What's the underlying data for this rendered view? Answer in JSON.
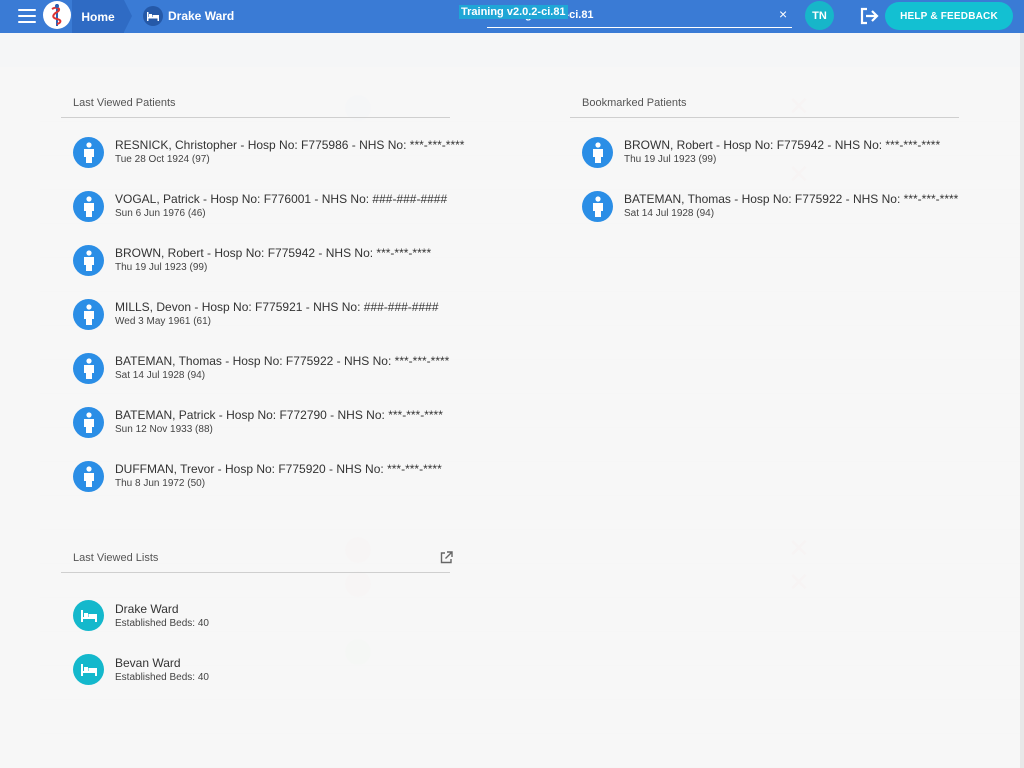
{
  "header": {
    "home_label": "Home",
    "ward_label": "Drake Ward",
    "search_value": "Training v2.0.2-ci.81",
    "clear_symbol": "×",
    "user_initials": "TN",
    "help_label": "HELP & FEEDBACK"
  },
  "colors": {
    "topbar": "#3a7bd5",
    "patient_icon": "#2b8ee6",
    "list_icon": "#14b8cc",
    "help_button": "#13c0d2"
  },
  "icons": [
    "menu-icon",
    "caduceus-logo-icon",
    "bed-icon",
    "close-icon",
    "logout-icon",
    "person-icon",
    "open-external-icon"
  ],
  "last_viewed": {
    "title": "Last Viewed Patients",
    "patients": [
      {
        "name": "RESNICK, Christopher - Hosp No: F775986 - NHS No: ***-***-****",
        "dob": "Tue 28 Oct 1924 (97)"
      },
      {
        "name": "VOGAL, Patrick - Hosp No: F776001 - NHS No: ###-###-####",
        "dob": "Sun 6 Jun 1976 (46)"
      },
      {
        "name": "BROWN, Robert - Hosp No: F775942 - NHS No: ***-***-****",
        "dob": "Thu 19 Jul 1923 (99)"
      },
      {
        "name": "MILLS, Devon - Hosp No: F775921 - NHS No: ###-###-####",
        "dob": "Wed 3 May 1961 (61)"
      },
      {
        "name": "BATEMAN, Thomas - Hosp No: F775922 - NHS No: ***-***-****",
        "dob": "Sat 14 Jul 1928 (94)"
      },
      {
        "name": "BATEMAN, Patrick - Hosp No: F772790 - NHS No: ***-***-****",
        "dob": "Sun 12 Nov 1933 (88)"
      },
      {
        "name": "DUFFMAN, Trevor - Hosp No: F775920 - NHS No: ***-***-****",
        "dob": "Thu 8 Jun 1972 (50)"
      }
    ]
  },
  "bookmarked": {
    "title": "Bookmarked Patients",
    "patients": [
      {
        "name": "BROWN, Robert - Hosp No: F775942 - NHS No: ***-***-****",
        "dob": "Thu 19 Jul 1923 (99)"
      },
      {
        "name": "BATEMAN, Thomas - Hosp No: F775922 - NHS No: ***-***-****",
        "dob": "Sat 14 Jul 1928 (94)"
      }
    ]
  },
  "last_lists": {
    "title": "Last Viewed Lists",
    "lists": [
      {
        "name": "Drake Ward",
        "detail": "Established Beds: 40"
      },
      {
        "name": "Bevan Ward",
        "detail": "Established Beds: 40"
      }
    ]
  }
}
